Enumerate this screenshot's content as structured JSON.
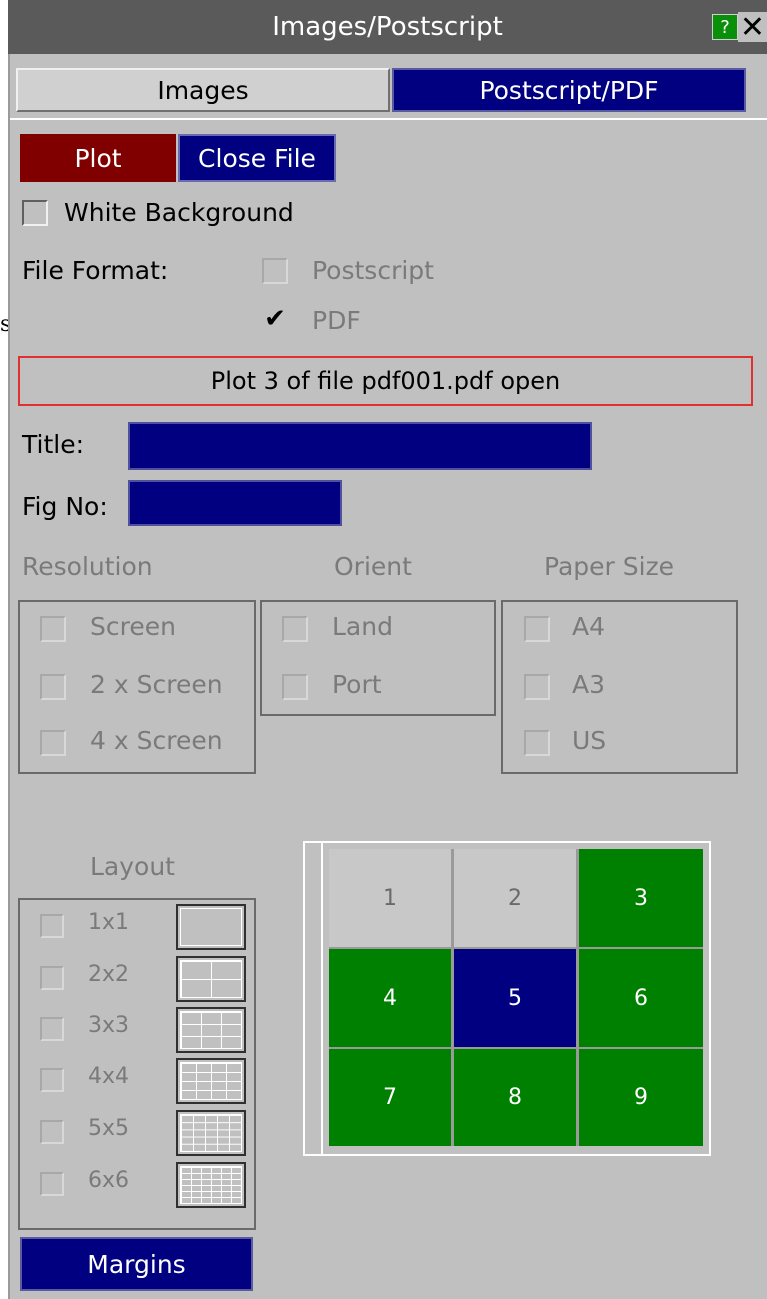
{
  "window": {
    "title": "Images/Postscript",
    "help_label": "?",
    "close_label": "✕"
  },
  "edge_text": "s",
  "tabs": [
    {
      "label": "Images",
      "active": false
    },
    {
      "label": "Postscript/PDF",
      "active": true
    }
  ],
  "actions": {
    "plot_label": "Plot",
    "close_file_label": "Close File"
  },
  "white_background": {
    "label": "White Background",
    "checked": false
  },
  "file_format": {
    "label": "File Format:",
    "options": [
      {
        "label": "Postscript",
        "checked": false
      },
      {
        "label": "PDF",
        "checked": true,
        "mark": "✔"
      }
    ]
  },
  "status_text": "Plot  3 of file pdf001.pdf open",
  "title_field": {
    "label": "Title:",
    "value": ""
  },
  "fig_field": {
    "label": "Fig No:",
    "value": ""
  },
  "resolution": {
    "heading": "Resolution",
    "options": [
      "Screen",
      "2 x Screen",
      "4 x Screen"
    ]
  },
  "orient": {
    "heading": "Orient",
    "options": [
      "Land",
      "Port"
    ]
  },
  "paper_size": {
    "heading": "Paper Size",
    "options": [
      "A4",
      "A3",
      "US"
    ]
  },
  "layout": {
    "heading": "Layout",
    "options": [
      "1x1",
      "2x2",
      "3x3",
      "4x4",
      "5x5",
      "6x6"
    ]
  },
  "grid": {
    "cells": [
      {
        "label": "1",
        "state": "empty"
      },
      {
        "label": "2",
        "state": "empty"
      },
      {
        "label": "3",
        "state": "filled"
      },
      {
        "label": "4",
        "state": "filled"
      },
      {
        "label": "5",
        "state": "current"
      },
      {
        "label": "6",
        "state": "filled"
      },
      {
        "label": "7",
        "state": "filled"
      },
      {
        "label": "8",
        "state": "filled"
      },
      {
        "label": "9",
        "state": "filled"
      }
    ],
    "colors": {
      "empty": "#c8c8c8",
      "filled": "#008000",
      "current": "#000080"
    }
  },
  "margins_label": "Margins"
}
